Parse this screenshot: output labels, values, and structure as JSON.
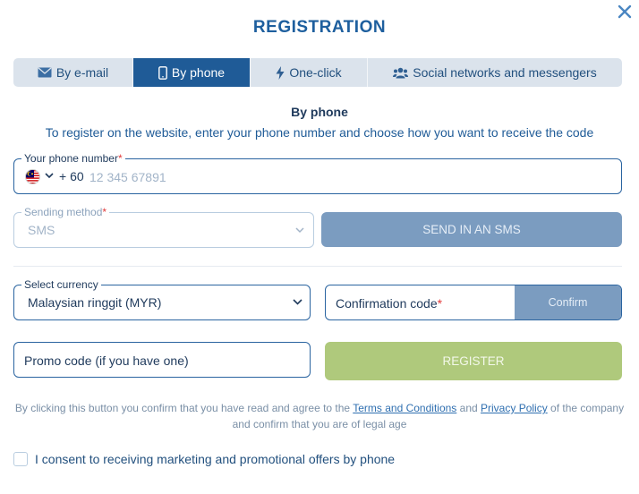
{
  "modal": {
    "title": "REGISTRATION",
    "close_icon": "close-icon"
  },
  "tabs": [
    {
      "label": "By e-mail",
      "icon": "envelope-icon",
      "active": false
    },
    {
      "label": "By phone",
      "icon": "smartphone-icon",
      "active": true
    },
    {
      "label": "One-click",
      "icon": "lightning-icon",
      "active": false
    },
    {
      "label": "Social networks and messengers",
      "icon": "users-icon",
      "active": false
    }
  ],
  "form": {
    "subtitle": "By phone",
    "description": "To register on the website, enter your phone number and choose how you want to receive the code",
    "phone": {
      "label": "Your phone number",
      "required_mark": "*",
      "country_flag": "malaysia-flag-icon",
      "prefix": "+ 60",
      "placeholder": "12 345 67891",
      "value": ""
    },
    "sending_method": {
      "label": "Sending method",
      "required_mark": "*",
      "value": "SMS"
    },
    "send_button": "SEND IN AN SMS",
    "currency": {
      "label": "Select currency",
      "value": "Malaysian ringgit (MYR)"
    },
    "confirmation_code": {
      "placeholder": "Confirmation code",
      "required_mark": "*",
      "button": "Confirm"
    },
    "promo_code": {
      "placeholder": "Promo code (if you have one)"
    },
    "register_button": "REGISTER",
    "terms": {
      "prefix": "By clicking this button you confirm that you have read and agree to the",
      "terms_link": "Terms and Conditions",
      "and": "and",
      "privacy_link": "Privacy Policy",
      "suffix": "of the company and confirm that you are of legal age"
    },
    "consent": {
      "label": "I consent to receiving marketing and promotional offers by phone",
      "checked": false
    }
  },
  "colors": {
    "primary": "#1f5b97",
    "accent_blue": "#2a64a0",
    "disabled_button": "#7b9cc0",
    "register_button": "#afc97c",
    "required": "#e13b3b"
  }
}
